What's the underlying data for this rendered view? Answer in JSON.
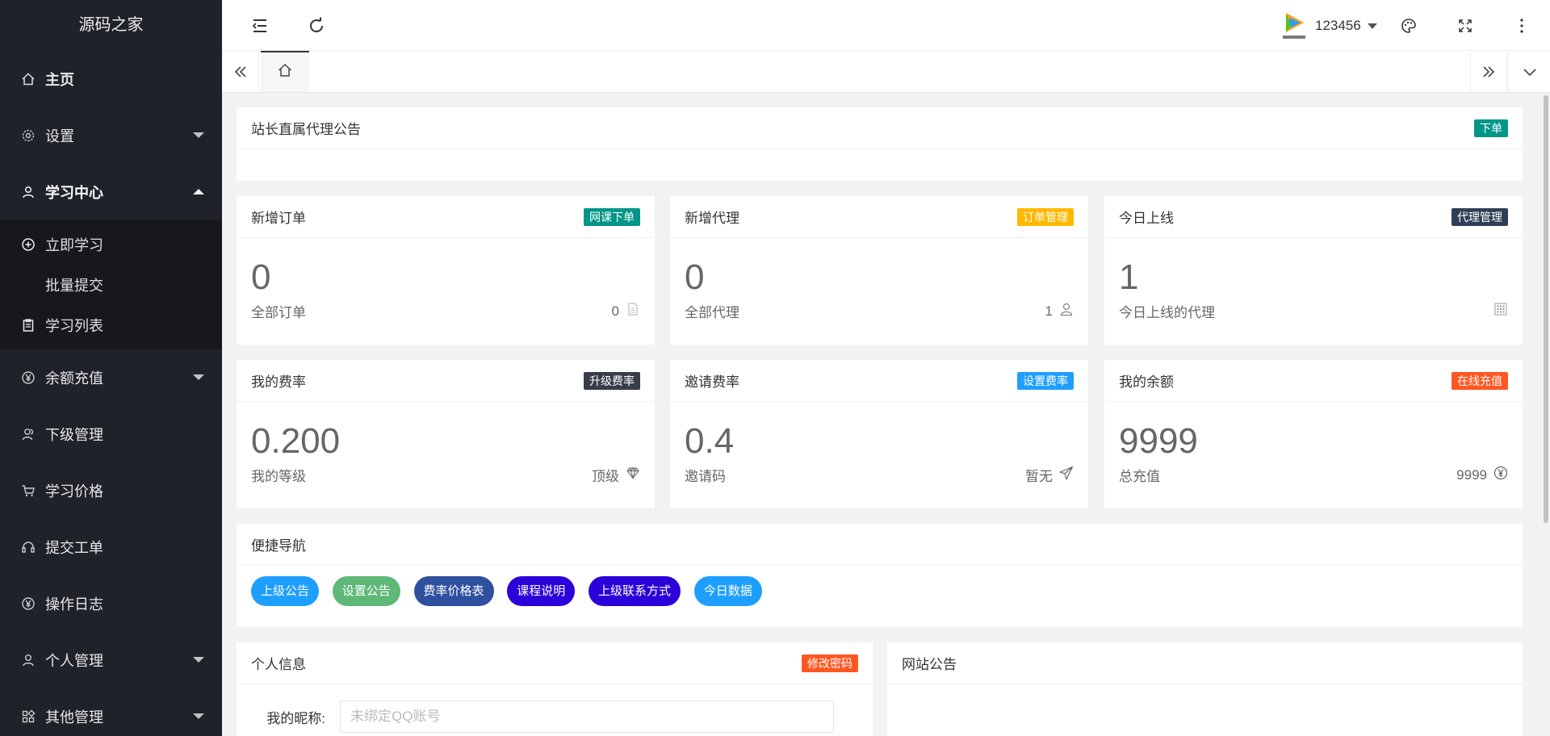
{
  "sidebar": {
    "logo": "源码之家",
    "items": [
      {
        "label": "主页"
      },
      {
        "label": "设置"
      },
      {
        "label": "学习中心"
      },
      {
        "label": "余额充值"
      },
      {
        "label": "下级管理"
      },
      {
        "label": "学习价格"
      },
      {
        "label": "提交工单"
      },
      {
        "label": "操作日志"
      },
      {
        "label": "个人管理"
      },
      {
        "label": "其他管理"
      }
    ],
    "sub_items": [
      {
        "label": "立即学习"
      },
      {
        "label": "批量提交"
      },
      {
        "label": "学习列表"
      }
    ]
  },
  "topbar": {
    "username": "123456",
    "avatar_icon": "tencent-video-logo"
  },
  "announcement": {
    "title": "站长直属代理公告",
    "badge": "下单",
    "badge_color": "#009688"
  },
  "stats": [
    {
      "title": "新增订单",
      "badge": "网课下单",
      "badge_color": "#009688",
      "value": "0",
      "sub_label": "全部订单",
      "sub_value": "0",
      "icon": "document-icon"
    },
    {
      "title": "新增代理",
      "badge": "订单管理",
      "badge_color": "#ffb800",
      "value": "0",
      "sub_label": "全部代理",
      "sub_value": "1",
      "icon": "users-icon"
    },
    {
      "title": "今日上线",
      "badge": "代理管理",
      "badge_color": "#2f4056",
      "value": "1",
      "sub_label": "今日上线的代理",
      "sub_value": "",
      "icon": "grid-icon"
    },
    {
      "title": "我的费率",
      "badge": "升级费率",
      "badge_color": "#393d49",
      "value": "0.200",
      "sub_label": "我的等级",
      "sub_value": "顶级",
      "icon": "diamond-icon"
    },
    {
      "title": "邀请费率",
      "badge": "设置费率",
      "badge_color": "#1e9fff",
      "value": "0.4",
      "sub_label": "邀请码",
      "sub_value": "暂无",
      "icon": "send-icon"
    },
    {
      "title": "我的余额",
      "badge": "在线充值",
      "badge_color": "#ff5722",
      "value": "9999",
      "sub_label": "总充值",
      "sub_value": "9999",
      "icon": "yen-icon"
    }
  ],
  "quick_nav": {
    "title": "便捷导航",
    "buttons": [
      {
        "label": "上级公告",
        "color": "#1e9fff"
      },
      {
        "label": "设置公告",
        "color": "#5fb878"
      },
      {
        "label": "费率价格表",
        "color": "#2f4f9f"
      },
      {
        "label": "课程说明",
        "color": "#2c00d9"
      },
      {
        "label": "上级联系方式",
        "color": "#2c00d9"
      },
      {
        "label": "今日数据",
        "color": "#1e9fff"
      }
    ]
  },
  "personal": {
    "title": "个人信息",
    "badge": "修改密码",
    "badge_color": "#ff5722",
    "nickname_label": "我的昵称:",
    "nickname_placeholder": "未绑定QQ账号"
  },
  "site_notice": {
    "title": "网站公告"
  }
}
